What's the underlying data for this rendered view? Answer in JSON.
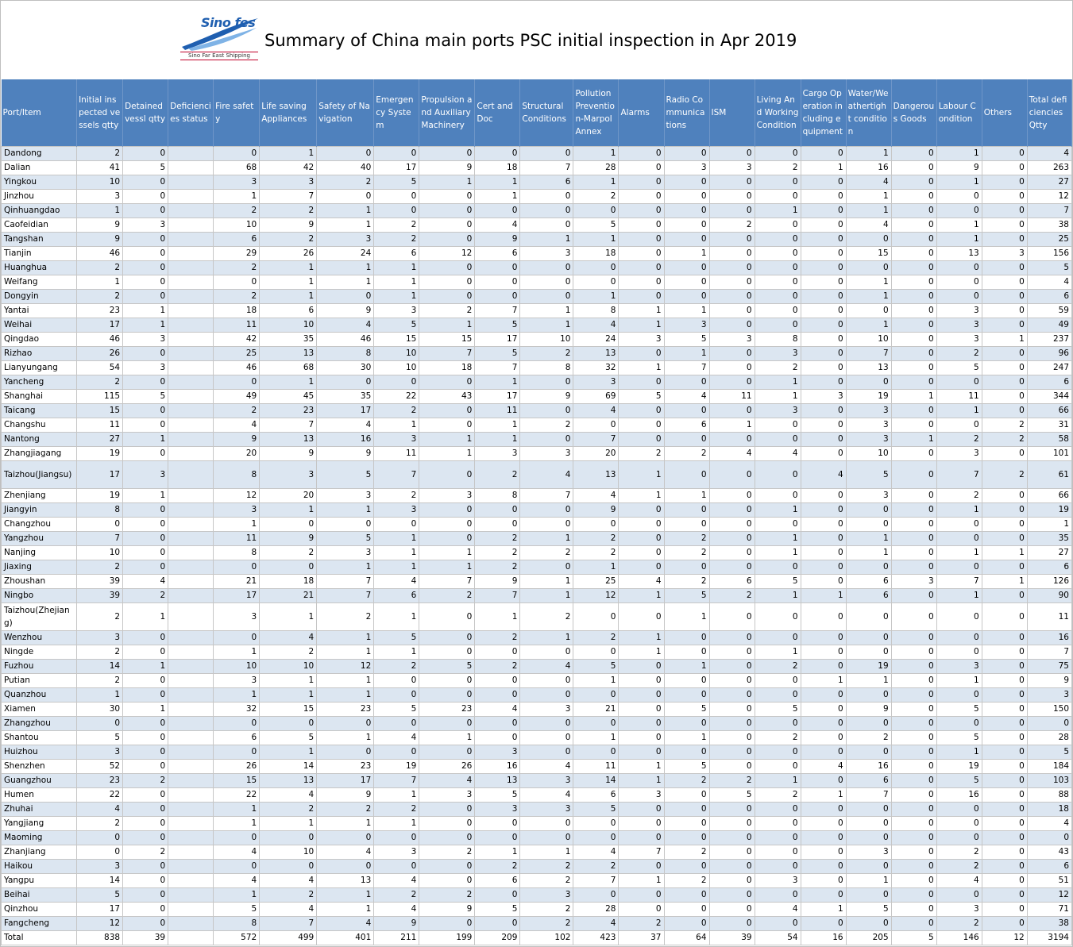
{
  "header": {
    "logo_text": "Sino fes",
    "logo_subtitle": "Sino Far East Shipping",
    "title": "Summary of China main ports PSC initial inspection in Apr 2019"
  },
  "columns": [
    "Port/Item",
    "Initial inspected vessels qtty",
    "Detained vessl qtty",
    "Deficiencies status",
    "Fire safety",
    "Life saving Appliances",
    "Safety of Navigation",
    "Emergency System",
    "Propulsion and Auxiliary Machinery",
    "Cert and Doc",
    "Structural Conditions",
    "Pollution Prevention-Marpol Annex",
    "Alarms",
    "Radio Communications",
    "ISM",
    "Living And Working Condition",
    "Cargo Operation including equipment",
    "Water/Weathertight condition",
    "Dangerous Goods",
    "Labour Condition",
    "Others",
    "Total deficiencies Qtty"
  ],
  "rows": [
    [
      "Dandong",
      "2",
      "0",
      "",
      "0",
      "1",
      "0",
      "0",
      "0",
      "0",
      "0",
      "1",
      "0",
      "0",
      "0",
      "0",
      "0",
      "1",
      "0",
      "1",
      "0",
      "4"
    ],
    [
      "Dalian",
      "41",
      "5",
      "",
      "68",
      "42",
      "40",
      "17",
      "9",
      "18",
      "7",
      "28",
      "0",
      "3",
      "3",
      "2",
      "1",
      "16",
      "0",
      "9",
      "0",
      "263"
    ],
    [
      "Yingkou",
      "10",
      "0",
      "",
      "3",
      "3",
      "2",
      "5",
      "1",
      "1",
      "6",
      "1",
      "0",
      "0",
      "0",
      "0",
      "0",
      "4",
      "0",
      "1",
      "0",
      "27"
    ],
    [
      "Jinzhou",
      "3",
      "0",
      "",
      "1",
      "7",
      "0",
      "0",
      "0",
      "1",
      "0",
      "2",
      "0",
      "0",
      "0",
      "0",
      "0",
      "1",
      "0",
      "0",
      "0",
      "12"
    ],
    [
      "Qinhuangdao",
      "1",
      "0",
      "",
      "2",
      "2",
      "1",
      "0",
      "0",
      "0",
      "0",
      "0",
      "0",
      "0",
      "0",
      "1",
      "0",
      "1",
      "0",
      "0",
      "0",
      "7"
    ],
    [
      "Caofeidian",
      "9",
      "3",
      "",
      "10",
      "9",
      "1",
      "2",
      "0",
      "4",
      "0",
      "5",
      "0",
      "0",
      "2",
      "0",
      "0",
      "4",
      "0",
      "1",
      "0",
      "38"
    ],
    [
      "Tangshan",
      "9",
      "0",
      "",
      "6",
      "2",
      "3",
      "2",
      "0",
      "9",
      "1",
      "1",
      "0",
      "0",
      "0",
      "0",
      "0",
      "0",
      "0",
      "1",
      "0",
      "25"
    ],
    [
      "Tianjin",
      "46",
      "0",
      "",
      "29",
      "26",
      "24",
      "6",
      "12",
      "6",
      "3",
      "18",
      "0",
      "1",
      "0",
      "0",
      "0",
      "15",
      "0",
      "13",
      "3",
      "156"
    ],
    [
      "Huanghua",
      "2",
      "0",
      "",
      "2",
      "1",
      "1",
      "1",
      "0",
      "0",
      "0",
      "0",
      "0",
      "0",
      "0",
      "0",
      "0",
      "0",
      "0",
      "0",
      "0",
      "5"
    ],
    [
      "Weifang",
      "1",
      "0",
      "",
      "0",
      "1",
      "1",
      "1",
      "0",
      "0",
      "0",
      "0",
      "0",
      "0",
      "0",
      "0",
      "0",
      "1",
      "0",
      "0",
      "0",
      "4"
    ],
    [
      "Dongyin",
      "2",
      "0",
      "",
      "2",
      "1",
      "0",
      "1",
      "0",
      "0",
      "0",
      "1",
      "0",
      "0",
      "0",
      "0",
      "0",
      "1",
      "0",
      "0",
      "0",
      "6"
    ],
    [
      "Yantai",
      "23",
      "1",
      "",
      "18",
      "6",
      "9",
      "3",
      "2",
      "7",
      "1",
      "8",
      "1",
      "1",
      "0",
      "0",
      "0",
      "0",
      "0",
      "3",
      "0",
      "59"
    ],
    [
      "Weihai",
      "17",
      "1",
      "",
      "11",
      "10",
      "4",
      "5",
      "1",
      "5",
      "1",
      "4",
      "1",
      "3",
      "0",
      "0",
      "0",
      "1",
      "0",
      "3",
      "0",
      "49"
    ],
    [
      "Qingdao",
      "46",
      "3",
      "",
      "42",
      "35",
      "46",
      "15",
      "15",
      "17",
      "10",
      "24",
      "3",
      "5",
      "3",
      "8",
      "0",
      "10",
      "0",
      "3",
      "1",
      "237"
    ],
    [
      "Rizhao",
      "26",
      "0",
      "",
      "25",
      "13",
      "8",
      "10",
      "7",
      "5",
      "2",
      "13",
      "0",
      "1",
      "0",
      "3",
      "0",
      "7",
      "0",
      "2",
      "0",
      "96"
    ],
    [
      "Lianyungang",
      "54",
      "3",
      "",
      "46",
      "68",
      "30",
      "10",
      "18",
      "7",
      "8",
      "32",
      "1",
      "7",
      "0",
      "2",
      "0",
      "13",
      "0",
      "5",
      "0",
      "247"
    ],
    [
      "Yancheng",
      "2",
      "0",
      "",
      "0",
      "1",
      "0",
      "0",
      "0",
      "1",
      "0",
      "3",
      "0",
      "0",
      "0",
      "1",
      "0",
      "0",
      "0",
      "0",
      "0",
      "6"
    ],
    [
      "Shanghai",
      "115",
      "5",
      "",
      "49",
      "45",
      "35",
      "22",
      "43",
      "17",
      "9",
      "69",
      "5",
      "4",
      "11",
      "1",
      "3",
      "19",
      "1",
      "11",
      "0",
      "344"
    ],
    [
      "Taicang",
      "15",
      "0",
      "",
      "2",
      "23",
      "17",
      "2",
      "0",
      "11",
      "0",
      "4",
      "0",
      "0",
      "0",
      "3",
      "0",
      "3",
      "0",
      "1",
      "0",
      "66"
    ],
    [
      "Changshu",
      "11",
      "0",
      "",
      "4",
      "7",
      "4",
      "1",
      "0",
      "1",
      "2",
      "0",
      "0",
      "6",
      "1",
      "0",
      "0",
      "3",
      "0",
      "0",
      "2",
      "31"
    ],
    [
      "Nantong",
      "27",
      "1",
      "",
      "9",
      "13",
      "16",
      "3",
      "1",
      "1",
      "0",
      "7",
      "0",
      "0",
      "0",
      "0",
      "0",
      "3",
      "1",
      "2",
      "2",
      "58"
    ],
    [
      "Zhangjiagang",
      "19",
      "0",
      "",
      "20",
      "9",
      "9",
      "11",
      "1",
      "3",
      "3",
      "20",
      "2",
      "2",
      "4",
      "4",
      "0",
      "10",
      "0",
      "3",
      "0",
      "101"
    ],
    [
      "Taizhou(Jiangsu)",
      "17",
      "3",
      "",
      "8",
      "3",
      "5",
      "7",
      "0",
      "2",
      "4",
      "13",
      "1",
      "0",
      "0",
      "0",
      "4",
      "5",
      "0",
      "7",
      "2",
      "61"
    ],
    [
      "Zhenjiang",
      "19",
      "1",
      "",
      "12",
      "20",
      "3",
      "2",
      "3",
      "8",
      "7",
      "4",
      "1",
      "1",
      "0",
      "0",
      "0",
      "3",
      "0",
      "2",
      "0",
      "66"
    ],
    [
      "Jiangyin",
      "8",
      "0",
      "",
      "3",
      "1",
      "1",
      "3",
      "0",
      "0",
      "0",
      "9",
      "0",
      "0",
      "0",
      "1",
      "0",
      "0",
      "0",
      "1",
      "0",
      "19"
    ],
    [
      "Changzhou",
      "0",
      "0",
      "",
      "1",
      "0",
      "0",
      "0",
      "0",
      "0",
      "0",
      "0",
      "0",
      "0",
      "0",
      "0",
      "0",
      "0",
      "0",
      "0",
      "0",
      "1"
    ],
    [
      "Yangzhou",
      "7",
      "0",
      "",
      "11",
      "9",
      "5",
      "1",
      "0",
      "2",
      "1",
      "2",
      "0",
      "2",
      "0",
      "1",
      "0",
      "1",
      "0",
      "0",
      "0",
      "35"
    ],
    [
      "Nanjing",
      "10",
      "0",
      "",
      "8",
      "2",
      "3",
      "1",
      "1",
      "2",
      "2",
      "2",
      "0",
      "2",
      "0",
      "1",
      "0",
      "1",
      "0",
      "1",
      "1",
      "27"
    ],
    [
      "Jiaxing",
      "2",
      "0",
      "",
      "0",
      "0",
      "1",
      "1",
      "1",
      "2",
      "0",
      "1",
      "0",
      "0",
      "0",
      "0",
      "0",
      "0",
      "0",
      "0",
      "0",
      "6"
    ],
    [
      "Zhoushan",
      "39",
      "4",
      "",
      "21",
      "18",
      "7",
      "4",
      "7",
      "9",
      "1",
      "25",
      "4",
      "2",
      "6",
      "5",
      "0",
      "6",
      "3",
      "7",
      "1",
      "126"
    ],
    [
      "Ningbo",
      "39",
      "2",
      "",
      "17",
      "21",
      "7",
      "6",
      "2",
      "7",
      "1",
      "12",
      "1",
      "5",
      "2",
      "1",
      "1",
      "6",
      "0",
      "1",
      "0",
      "90"
    ],
    [
      "Taizhou(Zhejiang)",
      "2",
      "1",
      "",
      "3",
      "1",
      "2",
      "1",
      "0",
      "1",
      "2",
      "0",
      "0",
      "1",
      "0",
      "0",
      "0",
      "0",
      "0",
      "0",
      "0",
      "11"
    ],
    [
      "Wenzhou",
      "3",
      "0",
      "",
      "0",
      "4",
      "1",
      "5",
      "0",
      "2",
      "1",
      "2",
      "1",
      "0",
      "0",
      "0",
      "0",
      "0",
      "0",
      "0",
      "0",
      "16"
    ],
    [
      "Ningde",
      "2",
      "0",
      "",
      "1",
      "2",
      "1",
      "1",
      "0",
      "0",
      "0",
      "0",
      "1",
      "0",
      "0",
      "1",
      "0",
      "0",
      "0",
      "0",
      "0",
      "7"
    ],
    [
      "Fuzhou",
      "14",
      "1",
      "",
      "10",
      "10",
      "12",
      "2",
      "5",
      "2",
      "4",
      "5",
      "0",
      "1",
      "0",
      "2",
      "0",
      "19",
      "0",
      "3",
      "0",
      "75"
    ],
    [
      "Putian",
      "2",
      "0",
      "",
      "3",
      "1",
      "1",
      "0",
      "0",
      "0",
      "0",
      "1",
      "0",
      "0",
      "0",
      "0",
      "1",
      "1",
      "0",
      "1",
      "0",
      "9"
    ],
    [
      "Quanzhou",
      "1",
      "0",
      "",
      "1",
      "1",
      "1",
      "0",
      "0",
      "0",
      "0",
      "0",
      "0",
      "0",
      "0",
      "0",
      "0",
      "0",
      "0",
      "0",
      "0",
      "3"
    ],
    [
      "Xiamen",
      "30",
      "1",
      "",
      "32",
      "15",
      "23",
      "5",
      "23",
      "4",
      "3",
      "21",
      "0",
      "5",
      "0",
      "5",
      "0",
      "9",
      "0",
      "5",
      "0",
      "150"
    ],
    [
      "Zhangzhou",
      "0",
      "0",
      "",
      "0",
      "0",
      "0",
      "0",
      "0",
      "0",
      "0",
      "0",
      "0",
      "0",
      "0",
      "0",
      "0",
      "0",
      "0",
      "0",
      "0",
      "0"
    ],
    [
      "Shantou",
      "5",
      "0",
      "",
      "6",
      "5",
      "1",
      "4",
      "1",
      "0",
      "0",
      "1",
      "0",
      "1",
      "0",
      "2",
      "0",
      "2",
      "0",
      "5",
      "0",
      "28"
    ],
    [
      "Huizhou",
      "3",
      "0",
      "",
      "0",
      "1",
      "0",
      "0",
      "0",
      "3",
      "0",
      "0",
      "0",
      "0",
      "0",
      "0",
      "0",
      "0",
      "0",
      "1",
      "0",
      "5"
    ],
    [
      "Shenzhen",
      "52",
      "0",
      "",
      "26",
      "14",
      "23",
      "19",
      "26",
      "16",
      "4",
      "11",
      "1",
      "5",
      "0",
      "0",
      "4",
      "16",
      "0",
      "19",
      "0",
      "184"
    ],
    [
      "Guangzhou",
      "23",
      "2",
      "",
      "15",
      "13",
      "17",
      "7",
      "4",
      "13",
      "3",
      "14",
      "1",
      "2",
      "2",
      "1",
      "0",
      "6",
      "0",
      "5",
      "0",
      "103"
    ],
    [
      "Humen",
      "22",
      "0",
      "",
      "22",
      "4",
      "9",
      "1",
      "3",
      "5",
      "4",
      "6",
      "3",
      "0",
      "5",
      "2",
      "1",
      "7",
      "0",
      "16",
      "0",
      "88"
    ],
    [
      "Zhuhai",
      "4",
      "0",
      "",
      "1",
      "2",
      "2",
      "2",
      "0",
      "3",
      "3",
      "5",
      "0",
      "0",
      "0",
      "0",
      "0",
      "0",
      "0",
      "0",
      "0",
      "18"
    ],
    [
      "Yangjiang",
      "2",
      "0",
      "",
      "1",
      "1",
      "1",
      "1",
      "0",
      "0",
      "0",
      "0",
      "0",
      "0",
      "0",
      "0",
      "0",
      "0",
      "0",
      "0",
      "0",
      "4"
    ],
    [
      "Maoming",
      "0",
      "0",
      "",
      "0",
      "0",
      "0",
      "0",
      "0",
      "0",
      "0",
      "0",
      "0",
      "0",
      "0",
      "0",
      "0",
      "0",
      "0",
      "0",
      "0",
      "0"
    ],
    [
      "Zhanjiang",
      "0",
      "2",
      "",
      "4",
      "10",
      "4",
      "3",
      "2",
      "1",
      "1",
      "4",
      "7",
      "2",
      "0",
      "0",
      "0",
      "3",
      "0",
      "2",
      "0",
      "43"
    ],
    [
      "Haikou",
      "3",
      "0",
      "",
      "0",
      "0",
      "0",
      "0",
      "0",
      "2",
      "2",
      "2",
      "0",
      "0",
      "0",
      "0",
      "0",
      "0",
      "0",
      "2",
      "0",
      "6"
    ],
    [
      "Yangpu",
      "14",
      "0",
      "",
      "4",
      "4",
      "13",
      "4",
      "0",
      "6",
      "2",
      "7",
      "1",
      "2",
      "0",
      "3",
      "0",
      "1",
      "0",
      "4",
      "0",
      "51"
    ],
    [
      "Beihai",
      "5",
      "0",
      "",
      "1",
      "2",
      "1",
      "2",
      "2",
      "0",
      "3",
      "0",
      "0",
      "0",
      "0",
      "0",
      "0",
      "0",
      "0",
      "0",
      "0",
      "12"
    ],
    [
      "Qinzhou",
      "17",
      "0",
      "",
      "5",
      "4",
      "1",
      "4",
      "9",
      "5",
      "2",
      "28",
      "0",
      "0",
      "0",
      "4",
      "1",
      "5",
      "0",
      "3",
      "0",
      "71"
    ],
    [
      "Fangcheng",
      "12",
      "0",
      "",
      "8",
      "7",
      "4",
      "9",
      "0",
      "0",
      "2",
      "4",
      "2",
      "0",
      "0",
      "0",
      "0",
      "0",
      "0",
      "2",
      "0",
      "38"
    ],
    [
      "Total",
      "838",
      "39",
      "",
      "572",
      "499",
      "401",
      "211",
      "199",
      "209",
      "102",
      "423",
      "37",
      "64",
      "39",
      "54",
      "16",
      "205",
      "5",
      "146",
      "12",
      "3194"
    ]
  ]
}
